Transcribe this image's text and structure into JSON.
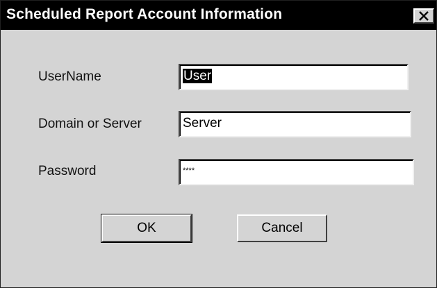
{
  "window": {
    "title": "Scheduled Report Account Information",
    "close_icon": "close-icon"
  },
  "form": {
    "username_label": "UserName",
    "username_value": "User",
    "domain_label": "Domain or Server",
    "domain_value": "Server",
    "password_label": "Password",
    "password_value": "****"
  },
  "buttons": {
    "ok_label": "OK",
    "cancel_label": "Cancel"
  },
  "colors": {
    "titlebar": "#000000",
    "dialog_background": "#d4d4d4",
    "field_background": "#ffffff"
  }
}
